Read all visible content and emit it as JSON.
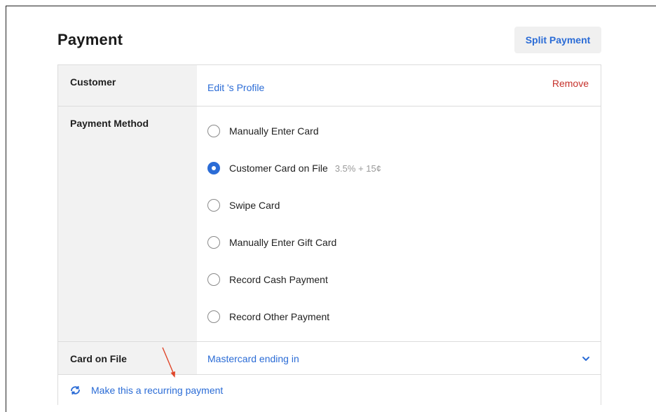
{
  "page": {
    "title": "Payment"
  },
  "toolbar": {
    "split_payment_label": "Split Payment"
  },
  "customer": {
    "label": "Customer",
    "edit_link": "Edit 's Profile",
    "remove_link": "Remove"
  },
  "payment_method": {
    "label": "Payment Method",
    "options": [
      {
        "label": "Manually Enter Card",
        "selected": false,
        "fee": ""
      },
      {
        "label": "Customer Card on File",
        "selected": true,
        "fee": "3.5% + 15¢"
      },
      {
        "label": "Swipe Card",
        "selected": false,
        "fee": ""
      },
      {
        "label": "Manually Enter Gift Card",
        "selected": false,
        "fee": ""
      },
      {
        "label": "Record Cash Payment",
        "selected": false,
        "fee": ""
      },
      {
        "label": "Record Other Payment",
        "selected": false,
        "fee": ""
      }
    ]
  },
  "card_on_file": {
    "label": "Card on File",
    "selected_value": "Mastercard ending in"
  },
  "recurring": {
    "label": "Make this a recurring payment"
  },
  "colors": {
    "accent": "#2b6cd6",
    "danger": "#c6312b",
    "annotation": "#e0462a"
  },
  "icons": {
    "recurring": "refresh-icon",
    "dropdown": "chevron-down-icon",
    "annotation": "arrow-annotation-icon"
  }
}
